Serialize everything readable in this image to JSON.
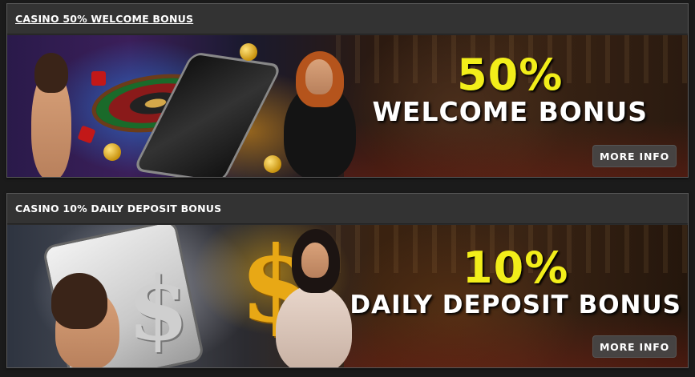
{
  "promos": [
    {
      "title": "CASINO 50% WELCOME BONUS",
      "percent": "50%",
      "label": "WELCOME BONUS",
      "button": "MORE INFO"
    },
    {
      "title": "CASINO 10% DAILY DEPOSIT BONUS",
      "percent": "10%",
      "label": "DAILY DEPOSIT BONUS",
      "button": "MORE INFO"
    }
  ],
  "colors": {
    "headline_accent": "#f2ee1a",
    "header_bg": "#333333",
    "button_bg": "#464646"
  },
  "icons": [
    "dollar-sign-icon"
  ]
}
